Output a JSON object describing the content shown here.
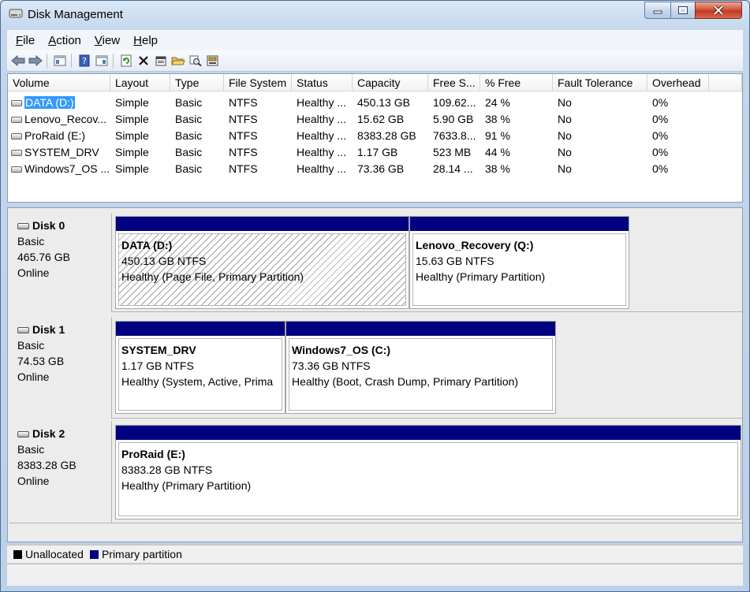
{
  "window": {
    "title": "Disk Management"
  },
  "menu": [
    {
      "accel": "F",
      "rest": "ile"
    },
    {
      "accel": "A",
      "rest": "ction"
    },
    {
      "accel": "V",
      "rest": "iew"
    },
    {
      "accel": "H",
      "rest": "elp"
    }
  ],
  "toolbar": [
    "back-icon",
    "forward-icon",
    "show-hide-console-tree-icon",
    "help-icon",
    "show-hide-action-pane-icon",
    "refresh-icon",
    "delete-icon",
    "properties-icon",
    "open-icon",
    "explore-icon",
    "disk-properties-icon"
  ],
  "table": {
    "columns": [
      "Volume",
      "Layout",
      "Type",
      "File System",
      "Status",
      "Capacity",
      "Free S...",
      "% Free",
      "Fault Tolerance",
      "Overhead"
    ],
    "rows": [
      [
        "DATA (D:)",
        "Simple",
        "Basic",
        "NTFS",
        "Healthy ...",
        "450.13 GB",
        "109.62...",
        "24 %",
        "No",
        "0%"
      ],
      [
        "Lenovo_Recov...",
        "Simple",
        "Basic",
        "NTFS",
        "Healthy ...",
        "15.62 GB",
        "5.90 GB",
        "38 %",
        "No",
        "0%"
      ],
      [
        "ProRaid (E:)",
        "Simple",
        "Basic",
        "NTFS",
        "Healthy ...",
        "8383.28 GB",
        "7633.8...",
        "91 %",
        "No",
        "0%"
      ],
      [
        "SYSTEM_DRV",
        "Simple",
        "Basic",
        "NTFS",
        "Healthy ...",
        "1.17 GB",
        "523 MB",
        "44 %",
        "No",
        "0%"
      ],
      [
        "Windows7_OS ...",
        "Simple",
        "Basic",
        "NTFS",
        "Healthy ...",
        "73.36 GB",
        "28.14 ...",
        "38 %",
        "No",
        "0%"
      ]
    ]
  },
  "disks": [
    {
      "name": "Disk 0",
      "type": "Basic",
      "size": "465.76 GB",
      "status": "Online",
      "partitions": [
        {
          "title": "DATA  (D:)",
          "size": "450.13 GB NTFS",
          "status": "Healthy (Page File, Primary Partition)"
        },
        {
          "title": "Lenovo_Recovery  (Q:)",
          "size": "15.63 GB NTFS",
          "status": "Healthy (Primary Partition)"
        }
      ]
    },
    {
      "name": "Disk 1",
      "type": "Basic",
      "size": "74.53 GB",
      "status": "Online",
      "partitions": [
        {
          "title": "SYSTEM_DRV",
          "size": "1.17 GB NTFS",
          "status": "Healthy (System, Active, Prima"
        },
        {
          "title": "Windows7_OS  (C:)",
          "size": "73.36 GB NTFS",
          "status": "Healthy (Boot, Crash Dump, Primary Partition)"
        }
      ]
    },
    {
      "name": "Disk 2",
      "type": "Basic",
      "size": "8383.28 GB",
      "status": "Online",
      "partitions": [
        {
          "title": "ProRaid  (E:)",
          "size": "8383.28 GB NTFS",
          "status": "Healthy (Primary Partition)"
        }
      ]
    }
  ],
  "legend": [
    {
      "label": "Unallocated",
      "color": "#000000"
    },
    {
      "label": "Primary partition",
      "color": "#000080"
    }
  ],
  "colors": {
    "primary_partition": "#000080",
    "selection": "#3399ff"
  }
}
